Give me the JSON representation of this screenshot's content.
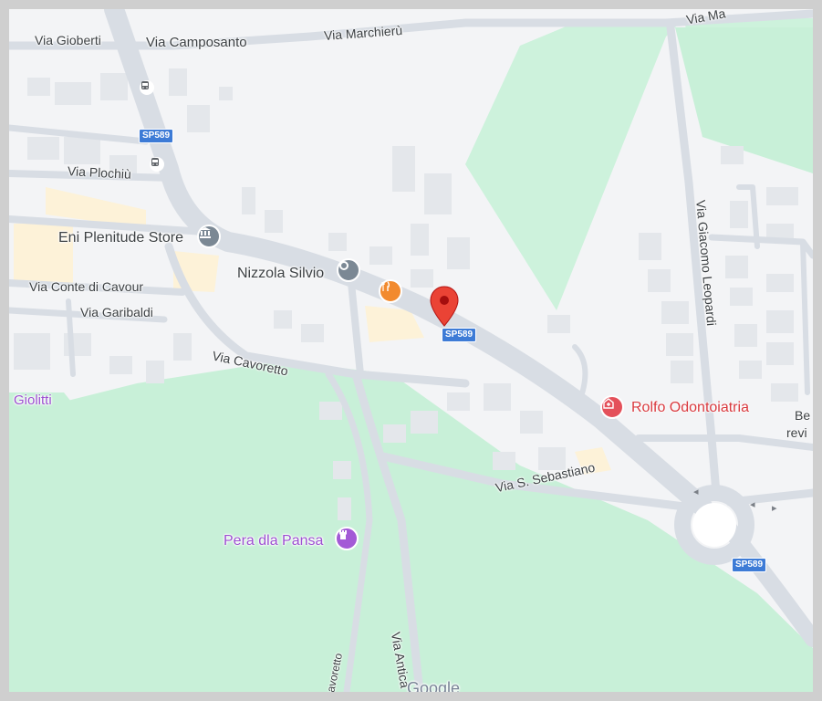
{
  "map": {
    "roads": {
      "via_gioberti": "Via Gioberti",
      "via_camposanto": "Via Camposanto",
      "via_marchieru": "Via Marchierù",
      "via_ma": "Via Ma",
      "via_plochiu": "Via Plochiù",
      "via_conte_di_cavour": "Via Conte di Cavour",
      "via_garibaldi": "Via Garibaldi",
      "via_cavoretto": "Via Cavoretto",
      "via_giacomo_leopardi": "Via Giacomo Leopardi",
      "via_s_sebastiano": "Via S. Sebastiano",
      "via_antica": "Via Antica",
      "cavoretto": "avoretto"
    },
    "road_shields": [
      "SP589",
      "SP589",
      "SP589"
    ],
    "places": {
      "eni_plenitude": "Eni Plenitude Store",
      "nizzola_silvio": "Nizzola Silvio",
      "rolfo": "Rolfo Odontoiatria",
      "pera_dla_pansa": "Pera dla Pansa",
      "giolitti": "Giolitti",
      "be_partial": "Be",
      "revi_partial": "revi"
    },
    "attribution": "Google",
    "icons": {
      "pin": "red-location-pin-icon",
      "bank": "bank-icon",
      "restaurant": "fork-knife-icon",
      "place": "place-dot-icon",
      "dentist": "medical-icon",
      "monument": "tower-icon",
      "bus": "bus-stop-icon"
    },
    "colors": {
      "land": "#f3f4f6",
      "park": "#c8f0d8",
      "road": "#d6dbe2",
      "building": "#e6e8ec",
      "commercial": "#fdf2d8",
      "pin": "#ea4335",
      "place_text_red": "#d9393e",
      "place_text_purple": "#9c4fd1",
      "shield": "#3d7bd6"
    }
  }
}
